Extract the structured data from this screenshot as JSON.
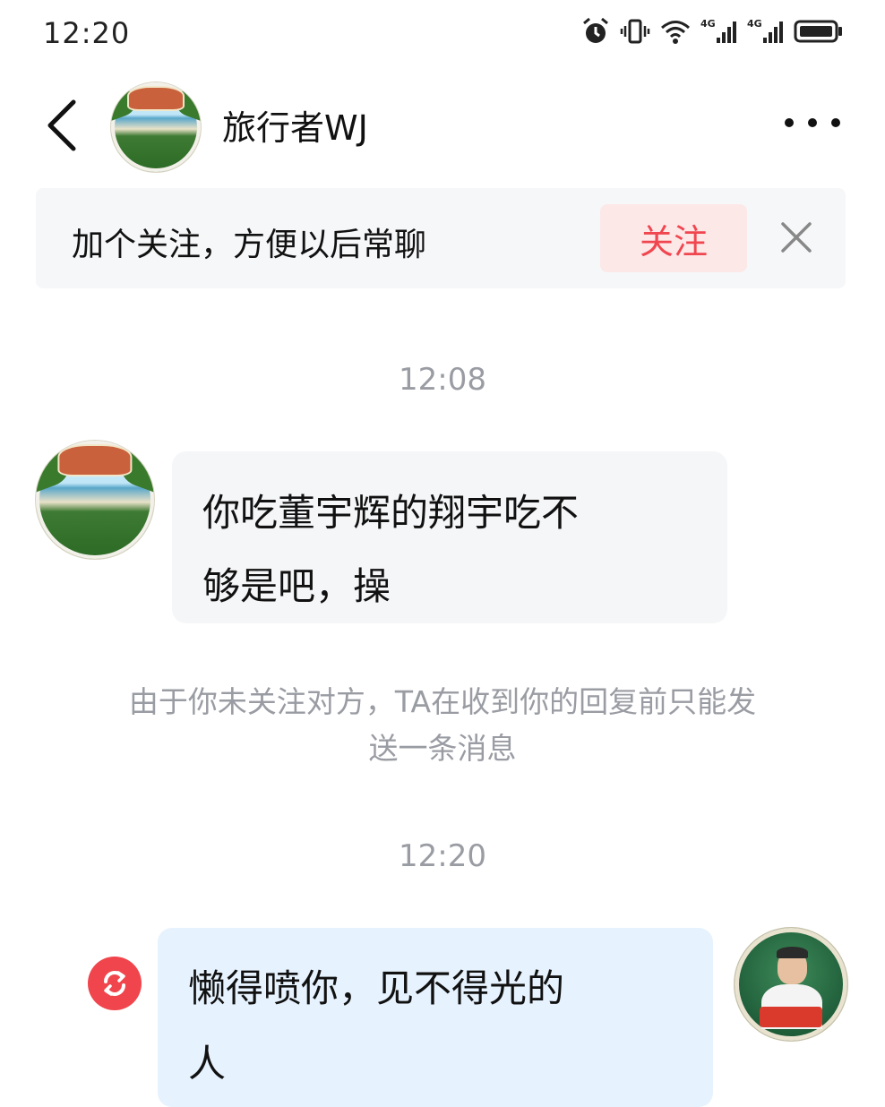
{
  "status_bar": {
    "time": "12:20",
    "icons": [
      "alarm-icon",
      "vibrate-icon",
      "wifi-icon",
      "signal-4g-icon",
      "signal-4g-icon",
      "battery-icon"
    ]
  },
  "header": {
    "back_icon": "chevron-left-icon",
    "contact_name": "旅行者WJ",
    "more_icon": "more-horizontal-icon"
  },
  "follow_banner": {
    "text": "加个关注，方便以后常聊",
    "button_label": "关注",
    "close_icon": "close-icon",
    "button_color": "#f0464f"
  },
  "messages": [
    {
      "type": "time",
      "text": "12:08"
    },
    {
      "type": "incoming",
      "lines": [
        "你吃董宇辉的翔宇吃不",
        "够是吧，操"
      ]
    },
    {
      "type": "notice",
      "lines": [
        "由于你未关注对方，TA在收到你的回复前只能发",
        "送一条消息"
      ]
    },
    {
      "type": "time",
      "text": "12:20"
    },
    {
      "type": "outgoing",
      "lines": [
        "懒得喷你，见不得光的",
        "人"
      ],
      "status_icon": "resend-icon"
    }
  ],
  "colors": {
    "accent_red": "#f0454c",
    "outgoing_bubble": "#e6f2fd",
    "incoming_bubble": "#f5f6f8",
    "muted_text": "#9a9ca3"
  }
}
